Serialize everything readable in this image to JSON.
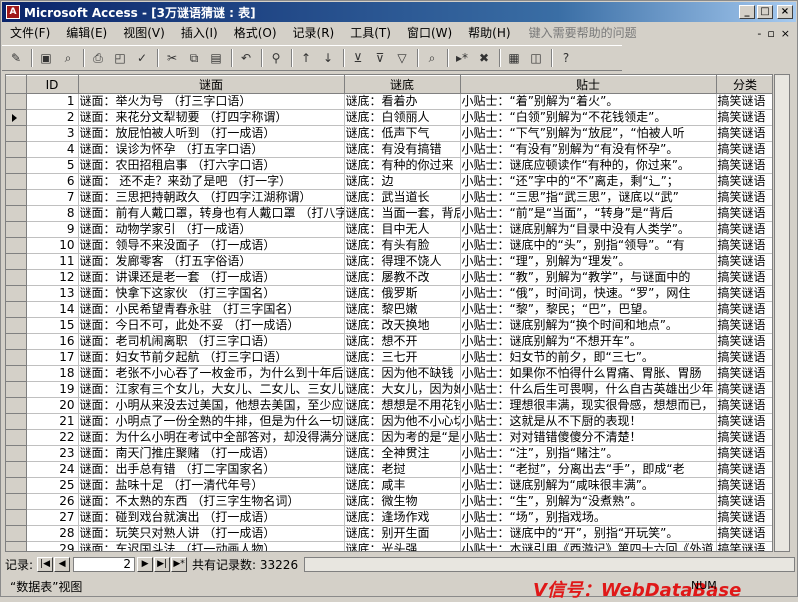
{
  "window": {
    "title": "Microsoft Access - [3万谜语猜谜 : 表]"
  },
  "menubar": {
    "items": [
      "文件(F)",
      "编辑(E)",
      "视图(V)",
      "插入(I)",
      "格式(O)",
      "记录(R)",
      "工具(T)",
      "窗口(W)",
      "帮助(H)"
    ],
    "help_placeholder": "键入需要帮助的问题"
  },
  "columns": [
    "ID",
    "谜面",
    "谜底",
    "贴士",
    "分类"
  ],
  "rows": [
    [
      "1",
      "谜面：举火为号 （打三字口语）",
      "谜底：看着办",
      "小贴士：“着”别解为“着火”。",
      "搞笑谜语"
    ],
    [
      "2",
      "谜面：来花分文犁韧要 （打四字称谓）",
      "谜底：白领丽人",
      "小贴士：“白领”别解为“不花钱领走”。",
      "搞笑谜语"
    ],
    [
      "3",
      "谜面：放屁怕被人听到 （打一成语）",
      "谜底：低声下气",
      "小贴士：“下气”别解为“放屁”，“怕被人听",
      "搞笑谜语"
    ],
    [
      "4",
      "谜面：误诊为怀孕 （打五字口语）",
      "谜底：有没有搞错",
      "小贴士：“有没有”别解为“有没有怀孕”。",
      "搞笑谜语"
    ],
    [
      "5",
      "谜面：农田招租启事 （打六字口语）",
      "谜底：有种的你过来",
      "小贴士：谜底应顿读作“有种的，你过来”。",
      "搞笑谜语"
    ],
    [
      "6",
      "谜面： 还不走？来劲了是吧 （打一字）",
      "谜底：边",
      "小贴士：“还”字中的“不”离走，剩“辶”；",
      "搞笑谜语"
    ],
    [
      "7",
      "谜面：三思把持朝政久 （打四字江湖称谓）",
      "谜底：武当道长",
      "小贴士：“三思”指“武三思”，谜底以“武”",
      "搞笑谜语"
    ],
    [
      "8",
      "谜面：前有人戴口罩，转身也有人戴口罩 （打八字",
      "谜底：当面一套，背后",
      "小贴士：“前”是“当面”，“转身”是“背后",
      "搞笑谜语"
    ],
    [
      "9",
      "谜面：动物学家引 （打一成语）",
      "谜底：目中无人",
      "小贴士：谜底别解为“目录中没有人类学”。",
      "搞笑谜语"
    ],
    [
      "10",
      "谜面：领导不来没面子 （打一成语）",
      "谜底：有头有脸",
      "小贴士：谜底中的“头”，别指“领导”。“有",
      "搞笑谜语"
    ],
    [
      "11",
      "谜面：发廊零客 （打五字俗语）",
      "谜底：得理不饶人",
      "小贴士：“理”，别解为“理发”。",
      "搞笑谜语"
    ],
    [
      "12",
      "谜面：讲课还是老一套 （打一成语）",
      "谜底：屡教不改",
      "小贴士：“教”，别解为“教学”，与谜面中的",
      "搞笑谜语"
    ],
    [
      "13",
      "谜面：快拿下这家伙 （打三字国名）",
      "谜底：俄罗斯",
      "小贴士：“俄”，时间词，快速。“罗”，网住",
      "搞笑谜语"
    ],
    [
      "14",
      "谜面：小民希望青春永驻 （打三字国名）",
      "谜底：黎巴嫩",
      "小贴士：“黎”，黎民；“巴”，巴望。",
      "搞笑谜语"
    ],
    [
      "15",
      "谜面：今日不可，此处不妥 （打一成语）",
      "谜底：改天换地",
      "小贴士：谜底别解为“换个时间和地点”。",
      "搞笑谜语"
    ],
    [
      "16",
      "谜面：老司机闹离职 （打三字口语）",
      "谜底：想不开",
      "小贴士：谜底别解为“不想开车”。",
      "搞笑谜语"
    ],
    [
      "17",
      "谜面：妇女节前夕起航 （打三字口语）",
      "谜底：三七开",
      "小贴士：妇女节的前夕，即“三七”。",
      "搞笑谜语"
    ],
    [
      "18",
      "谜面：老张不小心吞了一枚金币，为什么到十年后",
      "谜底：因为他不缺钱",
      "小贴士：如果你不怕得什么胃痛、胃胀、胃肠",
      "搞笑谜语"
    ],
    [
      "19",
      "谜面：江家有三个女儿，大女儿、二女儿、三女儿",
      "谜底：大女儿，因为她",
      "小贴士：什么后生可畏啊，什么自古英雄出少年",
      "搞笑谜语"
    ],
    [
      "20",
      "谜面：小明从来没去过美国，他想去美国，至少应",
      "谜底：想想是不用花钱",
      "小贴士：理想很丰满，现实很骨感，想想而已，",
      "搞笑谜语"
    ],
    [
      "21",
      "谜面：小明点了一份全熟的牛排，但是为什么一切",
      "谜底：因为他不小心切",
      "小贴士：这就是从不下厨的表现！",
      "搞笑谜语"
    ],
    [
      "22",
      "谜面：为什么小明在考试中全部答对，却没得满分",
      "谜底：因为考的是“是",
      "小贴士：对对错错傻傻分不清楚！",
      "搞笑谜语"
    ],
    [
      "23",
      "谜面：南天门推庄聚赌 （打一成语）",
      "谜底：全神贯注",
      "小贴士：“注”，别指“赌注”。",
      "搞笑谜语"
    ],
    [
      "24",
      "谜面：出手总有错 （打二字国家名）",
      "谜底：老挝",
      "小贴士：“老挝”，分离出去“手”，即成“老",
      "搞笑谜语"
    ],
    [
      "25",
      "谜面：盐味十足 （打一清代年号）",
      "谜底：咸丰",
      "小贴士：谜底别解为“咸味很丰满”。",
      "搞笑谜语"
    ],
    [
      "26",
      "谜面：不太熟的东西 （打三字生物名词）",
      "谜底：微生物",
      "小贴士：“生”，别解为“没煮熟”。",
      "搞笑谜语"
    ],
    [
      "27",
      "谜面：碰到戏台就演出 （打一成语）",
      "谜底：逢场作戏",
      "小贴士：“场”，别指戏场。",
      "搞笑谜语"
    ],
    [
      "28",
      "谜面：玩笑只对熟人讲 （打一成语）",
      "谜底：别开生面",
      "小贴士：谜底中的“开”，别指“开玩笑”。",
      "搞笑谜语"
    ],
    [
      "29",
      "谜面：车迟国斗法 （打一动画人物）",
      "谜底：光头强",
      "小贴士：本谜引用《西游记》第四十六回《外道",
      "搞笑谜语"
    ]
  ],
  "selected_row": 1,
  "navigator": {
    "label": "记录:",
    "current": "2",
    "total_label": "共有记录数: 33226"
  },
  "status": {
    "view": "“数据表”视图",
    "numlock": "NUM"
  },
  "watermark": "V信号：WebDataBase"
}
